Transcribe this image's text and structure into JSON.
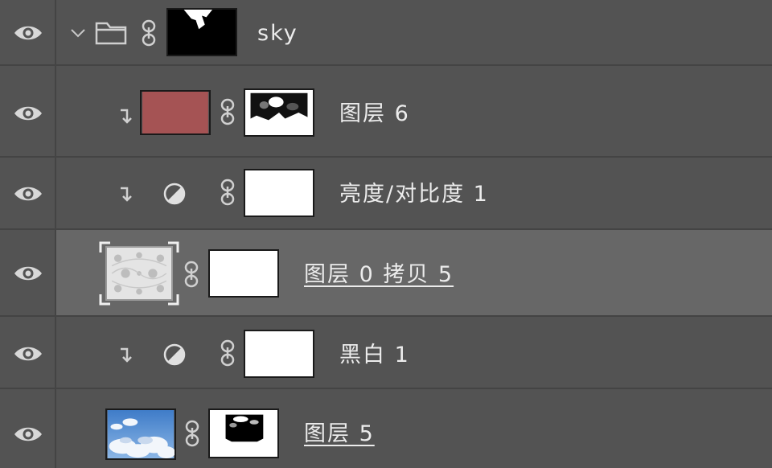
{
  "panel": {
    "title": "",
    "layers": [
      {
        "name": "sky",
        "kind": "group",
        "visible": true,
        "expanded": true
      },
      {
        "name": "图层 6",
        "kind": "pixel",
        "clipped": true,
        "visible": true,
        "thumb_color": "#a55354"
      },
      {
        "name": "亮度/对比度 1",
        "kind": "adjustment",
        "clipped": true,
        "visible": true
      },
      {
        "name": "图层 0 拷贝 5",
        "kind": "smart-object",
        "selected": true,
        "visible": true
      },
      {
        "name": "黑白 1",
        "kind": "adjustment",
        "clipped": true,
        "visible": true
      },
      {
        "name": "图层 5",
        "kind": "pixel",
        "visible": true
      }
    ]
  },
  "colors": {
    "panel_bg": "#535353",
    "selected_row_bg": "#676767",
    "divider": "#444444",
    "text": "#ececec",
    "red_fill": "#a55354",
    "sky_blue": "#6f9fd6"
  },
  "icons": {
    "visibility": "eye-icon",
    "expand": "chevron-down-icon",
    "group": "folder-icon",
    "mask_link": "chain-link-icon",
    "clipping": "clipping-mask-arrow-icon",
    "adjustment": "half-circle-adjustment-icon"
  }
}
